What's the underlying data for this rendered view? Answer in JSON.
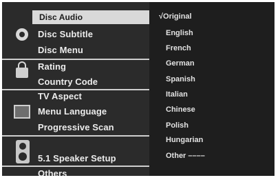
{
  "menu": {
    "items": [
      {
        "label": "Disc Audio",
        "selected": true
      },
      {
        "label": "Disc Subtitle"
      },
      {
        "label": "Disc Menu"
      },
      {
        "label": "Rating"
      },
      {
        "label": "Country Code"
      },
      {
        "label": "TV Aspect"
      },
      {
        "label": "Menu Language"
      },
      {
        "label": "Progressive Scan"
      },
      {
        "label": "5.1 Speaker Setup"
      },
      {
        "label": "Others"
      }
    ],
    "icons": [
      "disc-icon",
      "lock-icon",
      "tv-icon",
      "speaker-icon"
    ]
  },
  "options": {
    "items": [
      {
        "label": "√Original",
        "checked": true
      },
      {
        "label": "English"
      },
      {
        "label": "French"
      },
      {
        "label": "German"
      },
      {
        "label": "Spanish"
      },
      {
        "label": "Italian"
      },
      {
        "label": "Chinese"
      },
      {
        "label": "Polish"
      },
      {
        "label": "Hungarian"
      },
      {
        "label": "Other ––––"
      }
    ]
  },
  "colors": {
    "background": "#1e1e1e",
    "left_panel": "#2b2b2b",
    "highlight": "#d9d9d9",
    "text": "#ececec"
  }
}
